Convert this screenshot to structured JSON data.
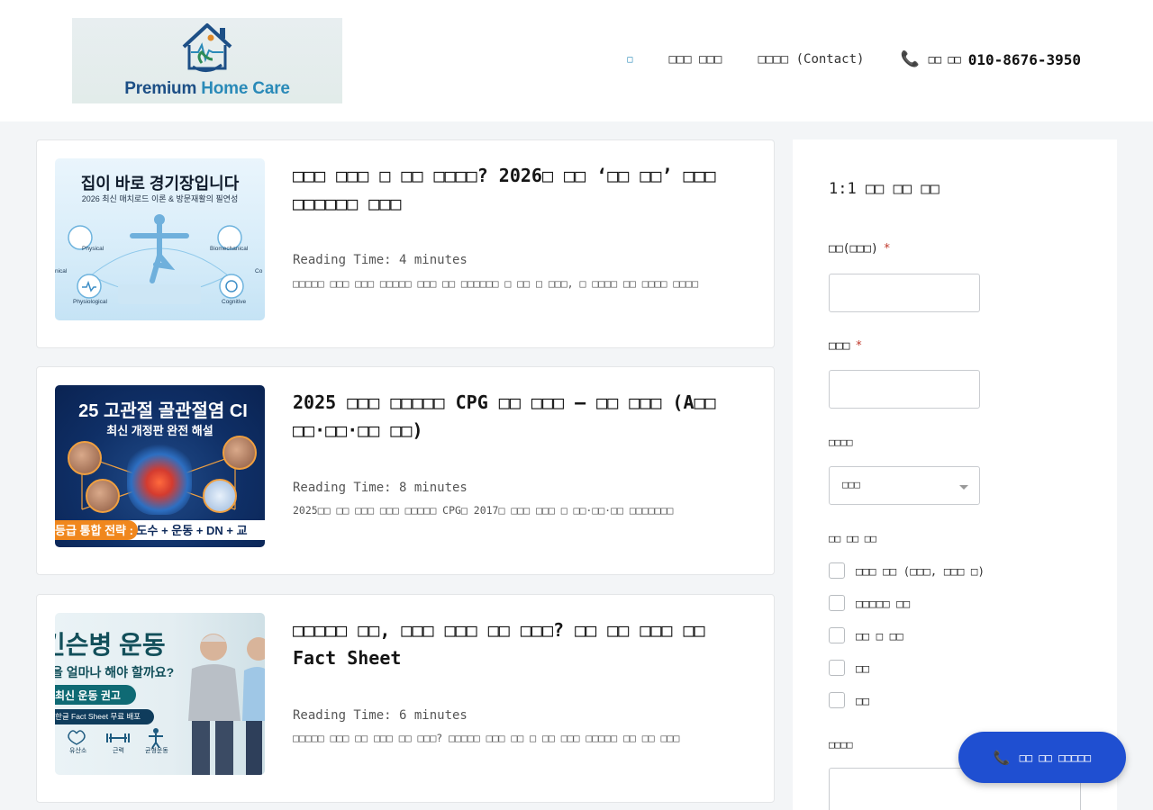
{
  "header": {
    "logo": {
      "text_main": "Premium ",
      "text_accent": "Home Care"
    },
    "nav": {
      "home_label": "□",
      "item2": "□□□ □□□",
      "item3": "□□□□ (Contact)",
      "phone_label": "□□ □□",
      "phone_number": "010-8676-3950",
      "phone_icon": "phone-icon"
    }
  },
  "posts": [
    {
      "title": "□□□ □□□ □ □□ □□□□? 2026□ □□ ‘□□ □□’ □□□ □□□□□□ □□□",
      "reading_time": "Reading Time: 4 minutes",
      "excerpt": "□□□□□ □□□ □□□ □□□□□ □□□ □□ □□□□□□ □ □□ □ □□□, □ □□□□ □□ □□□□ □□□□",
      "image": {
        "headline": "집이 바로 경기장입니다",
        "subline": "2026 최신 매치로드 이론 & 방문재활의 필연성",
        "labels": [
          "Physical",
          "Biomechanical",
          "Physiological",
          "Cognitive",
          "nical",
          "Co"
        ]
      }
    },
    {
      "title": "2025 □□□ □□□□□ CPG □□ □□□ — □□ □□□ (A□□ □□·□□·□□ □□)",
      "reading_time": "Reading Time: 8 minutes",
      "excerpt": "2025□□ □□ □□□ □□□ □□□□□ CPG□ 2017□ □□□ □□□ □ □□·□□·□□ □□□□□□□",
      "image": {
        "headline": "25 고관절 골관절염 CI",
        "subline": "최신 개정판 완전 해설",
        "band_orange": "등급 통합 전략 : ",
        "band_rest": "도수 + 운동 + DN + 교"
      }
    },
    {
      "title": "□□□□□ □□, □□□ □□□ □□ □□□? □□ □□ □□□ □□ Fact Sheet",
      "reading_time": "Reading Time: 6 minutes",
      "excerpt": "□□□□□ □□□ □□ □□□ □□ □□□? □□□□□ □□□ □□ □ □□ □□□ □□□□□ □□ □□ □□□",
      "image": {
        "headline": "킨슨병 운동",
        "subline": "을 얼마나 해야 할까요?",
        "pill": "최신 운동 권고",
        "sub": "한글 Fact Sheet 무료 배포",
        "tags": [
          "유산소",
          "근력",
          "균형운동"
        ]
      }
    }
  ],
  "sidebar": {
    "title": "1:1 □□ □□ □□",
    "name_label": "□□(□□□)",
    "name_required": "*",
    "phone_label": "□□□",
    "phone_required": "*",
    "region_label": "□□□□",
    "region_selected": "□□□",
    "area_label": "□□ □□ □□",
    "checks": [
      "□□□ □□ (□□□, □□□ □)",
      "□□□□□ □□",
      "□□ □ □□",
      "□□",
      "□□"
    ],
    "message_label": "□□□□"
  },
  "fab": {
    "label": "□□ □□ □□□□□",
    "icon": "phone-icon"
  },
  "colors": {
    "accent": "#2a8ab8",
    "fab": "#1f4fd1",
    "required": "#c0392b"
  }
}
